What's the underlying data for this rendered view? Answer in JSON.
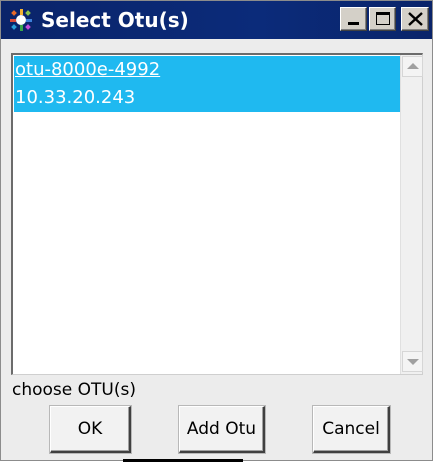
{
  "window": {
    "title": "Select Otu(s)",
    "controls": {
      "minimize": "minimize-icon",
      "maximize": "maximize-icon",
      "close": "close-icon"
    }
  },
  "list": {
    "items": [
      {
        "label": "otu-8000e-4992",
        "selected": true
      },
      {
        "label": "10.33.20.243",
        "selected": true
      }
    ],
    "selection_color": "#1fb9f0"
  },
  "status": {
    "text": "choose OTU(s)"
  },
  "buttons": {
    "ok": "OK",
    "add_otu": "Add Otu",
    "cancel": "Cancel"
  },
  "colors": {
    "titlebar": "#0a246a",
    "window_bg": "#ececec"
  }
}
